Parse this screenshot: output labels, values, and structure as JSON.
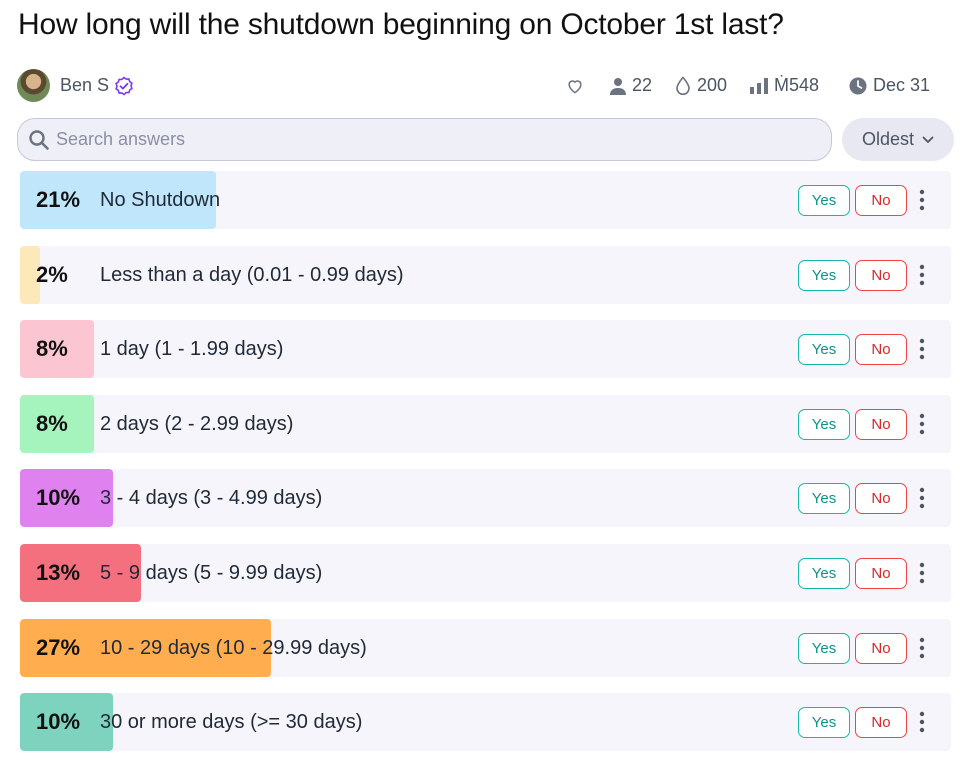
{
  "market": {
    "title": "How long will the shutdown beginning on October 1st last?",
    "author": "Ben S",
    "traders": "22",
    "volume": "200",
    "liquidity": "Ṁ548",
    "close_date": "Dec 31"
  },
  "search": {
    "placeholder": "Search answers",
    "value": ""
  },
  "sort": {
    "label": "Oldest"
  },
  "buttons": {
    "yes": "Yes",
    "no": "No"
  },
  "answers": [
    {
      "pct": "21%",
      "label": "No Shutdown",
      "prob": 0.21,
      "color": "#bfe6fb"
    },
    {
      "pct": "2%",
      "label": "Less than a day (0.01 - 0.99 days)",
      "prob": 0.02,
      "color": "#fde8b9"
    },
    {
      "pct": "8%",
      "label": "1 day (1 - 1.99 days)",
      "prob": 0.08,
      "color": "#fbc6d2"
    },
    {
      "pct": "8%",
      "label": "2 days (2 - 2.99 days)",
      "prob": 0.08,
      "color": "#a6f4bd"
    },
    {
      "pct": "10%",
      "label": "3 - 4 days (3 - 4.99 days)",
      "prob": 0.1,
      "color": "#df81ee"
    },
    {
      "pct": "13%",
      "label": "5 - 9 days (5 - 9.99 days)",
      "prob": 0.13,
      "color": "#f4707e"
    },
    {
      "pct": "27%",
      "label": "10 - 29 days (10 - 29.99 days)",
      "prob": 0.27,
      "color": "#ffad4e"
    },
    {
      "pct": "10%",
      "label": "30 or more days (>= 30 days)",
      "prob": 0.1,
      "color": "#7dd3bd"
    }
  ]
}
